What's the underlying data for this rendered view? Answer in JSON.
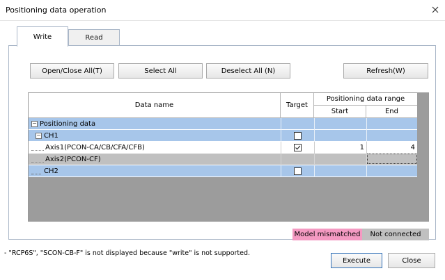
{
  "window": {
    "title": "Positioning data operation"
  },
  "tabs": [
    {
      "label": "Write",
      "active": true
    },
    {
      "label": "Read",
      "active": false
    }
  ],
  "toolbar": {
    "open_close_all": "Open/Close All(T)",
    "select_all": "Select All",
    "deselect_all": "Deselect All (N)",
    "refresh": "Refresh(W)"
  },
  "table": {
    "headers": {
      "data_name": "Data name",
      "target": "Target",
      "range_group": "Positioning data range",
      "start": "Start",
      "end": "End"
    },
    "rows": [
      {
        "name": "Positioning data",
        "level": 0,
        "expander": "−",
        "target": "",
        "start": "",
        "end": "",
        "style": "blue"
      },
      {
        "name": "CH1",
        "level": 1,
        "expander": "−",
        "target": "unchecked",
        "start": "",
        "end": "",
        "style": "blue"
      },
      {
        "name": "Axis1(PCON-CA/CB/CFA/CFB)",
        "level": 2,
        "expander": "",
        "target": "checked",
        "start": "1",
        "end": "4",
        "style": "white"
      },
      {
        "name": "Axis2(PCON-CF)",
        "level": 2,
        "expander": "",
        "target": "",
        "start": "",
        "end": "",
        "style": "grey"
      },
      {
        "name": "CH2",
        "level": 1,
        "expander": "",
        "target": "unchecked",
        "start": "",
        "end": "",
        "style": "blue"
      }
    ]
  },
  "legend": {
    "mismatch": {
      "label": "Model mismatched",
      "color": "#f49ac2"
    },
    "not_connected": {
      "label": "Not connected",
      "color": "#c0c0c0"
    }
  },
  "footer": {
    "note": "- \"RCP6S\", \"SCON-CB-F\" is not displayed because \"write\" is not supported.",
    "execute": "Execute",
    "close": "Close"
  },
  "colors": {
    "row_blue": "#a7c6ea",
    "grid_bg": "#9c9c9c",
    "accent": "#2f6fb7"
  }
}
